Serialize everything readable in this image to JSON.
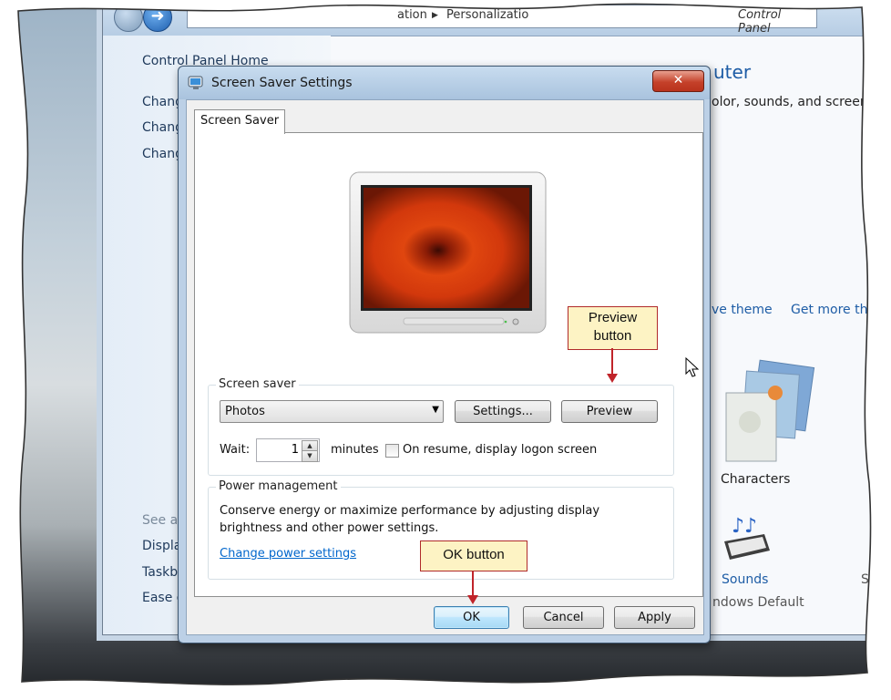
{
  "control_panel": {
    "breadcrumb_parts": [
      "ation",
      "Personalizatio"
    ],
    "breadcrumb_right": "Control Panel",
    "left_links": [
      "Control Panel Home",
      "Chang",
      "Chang",
      "Chang"
    ],
    "see_also_label": "See als",
    "see_also_links": [
      "Displa",
      "Taskb",
      "Ease o"
    ],
    "title": "uter",
    "subtitle": "olor, sounds, and screen sa",
    "theme_links": [
      "ve theme",
      "Get more th"
    ],
    "theme_name": "Characters",
    "sounds_label": "Sounds",
    "sounds_value": "ndows Default",
    "right_edge_letter": "S"
  },
  "dialog": {
    "title": "Screen Saver Settings",
    "close_glyph": "✕",
    "tab": "Screen Saver",
    "screen_saver_group": {
      "label": "Screen saver",
      "selected": "Photos",
      "settings_button": "Settings...",
      "preview_button": "Preview",
      "wait_label": "Wait:",
      "wait_value": "1",
      "minutes_label": "minutes",
      "resume_checkbox_label": "On resume, display logon screen",
      "resume_checked": false
    },
    "power_group": {
      "label": "Power management",
      "description_line1": "Conserve energy or maximize performance by adjusting display",
      "description_line2": "brightness and other power settings.",
      "link": "Change power settings"
    },
    "buttons": {
      "ok": "OK",
      "cancel": "Cancel",
      "apply": "Apply"
    }
  },
  "callouts": {
    "preview_line1": "Preview",
    "preview_line2": "button",
    "ok": "OK button"
  },
  "colors": {
    "callout_border": "#b02a2a",
    "callout_fill": "#fdf3c4",
    "link": "#0066cc"
  }
}
